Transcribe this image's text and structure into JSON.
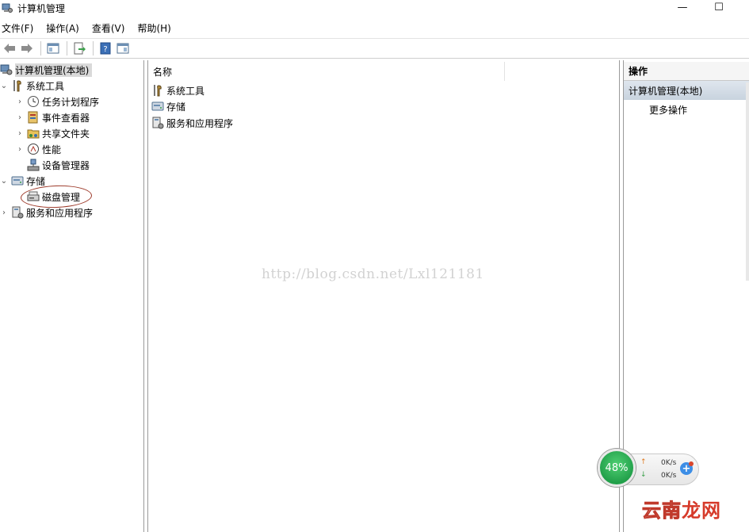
{
  "window": {
    "title": "计算机管理",
    "minimize": "—",
    "maximize": "☐"
  },
  "menu": [
    {
      "label": "文件(F)"
    },
    {
      "label": "操作(A)"
    },
    {
      "label": "查看(V)"
    },
    {
      "label": "帮助(H)"
    }
  ],
  "toolbar": {
    "buttons": [
      "back-icon",
      "forward-icon",
      "show-hide-tree-icon",
      "export-list-icon",
      "help-icon",
      "show-hide-action-pane-icon"
    ]
  },
  "tree": {
    "root": "计算机管理(本地)",
    "system_tools": "系统工具",
    "task_scheduler": "任务计划程序",
    "event_viewer": "事件查看器",
    "shared_folders": "共享文件夹",
    "performance": "性能",
    "device_manager": "设备管理器",
    "storage": "存储",
    "disk_management": "磁盘管理",
    "services_apps": "服务和应用程序"
  },
  "list": {
    "column_name": "名称",
    "items": [
      "系统工具",
      "存储",
      "服务和应用程序"
    ]
  },
  "watermark": "http://blog.csdn.net/Lxl121181",
  "actions": {
    "header": "操作",
    "section": "计算机管理(本地)",
    "more": "更多操作"
  },
  "speed_widget": {
    "percent": "48%",
    "up": "0K/s",
    "down": "0K/s",
    "plus": "+"
  },
  "logo": {
    "text_a": "云南",
    "text_b": "龙网"
  },
  "colors": {
    "selection": "#d9d9d9",
    "action_section": "#c8d3de",
    "speed_green": "#22a04a",
    "annotation": "#9d3a2a"
  }
}
